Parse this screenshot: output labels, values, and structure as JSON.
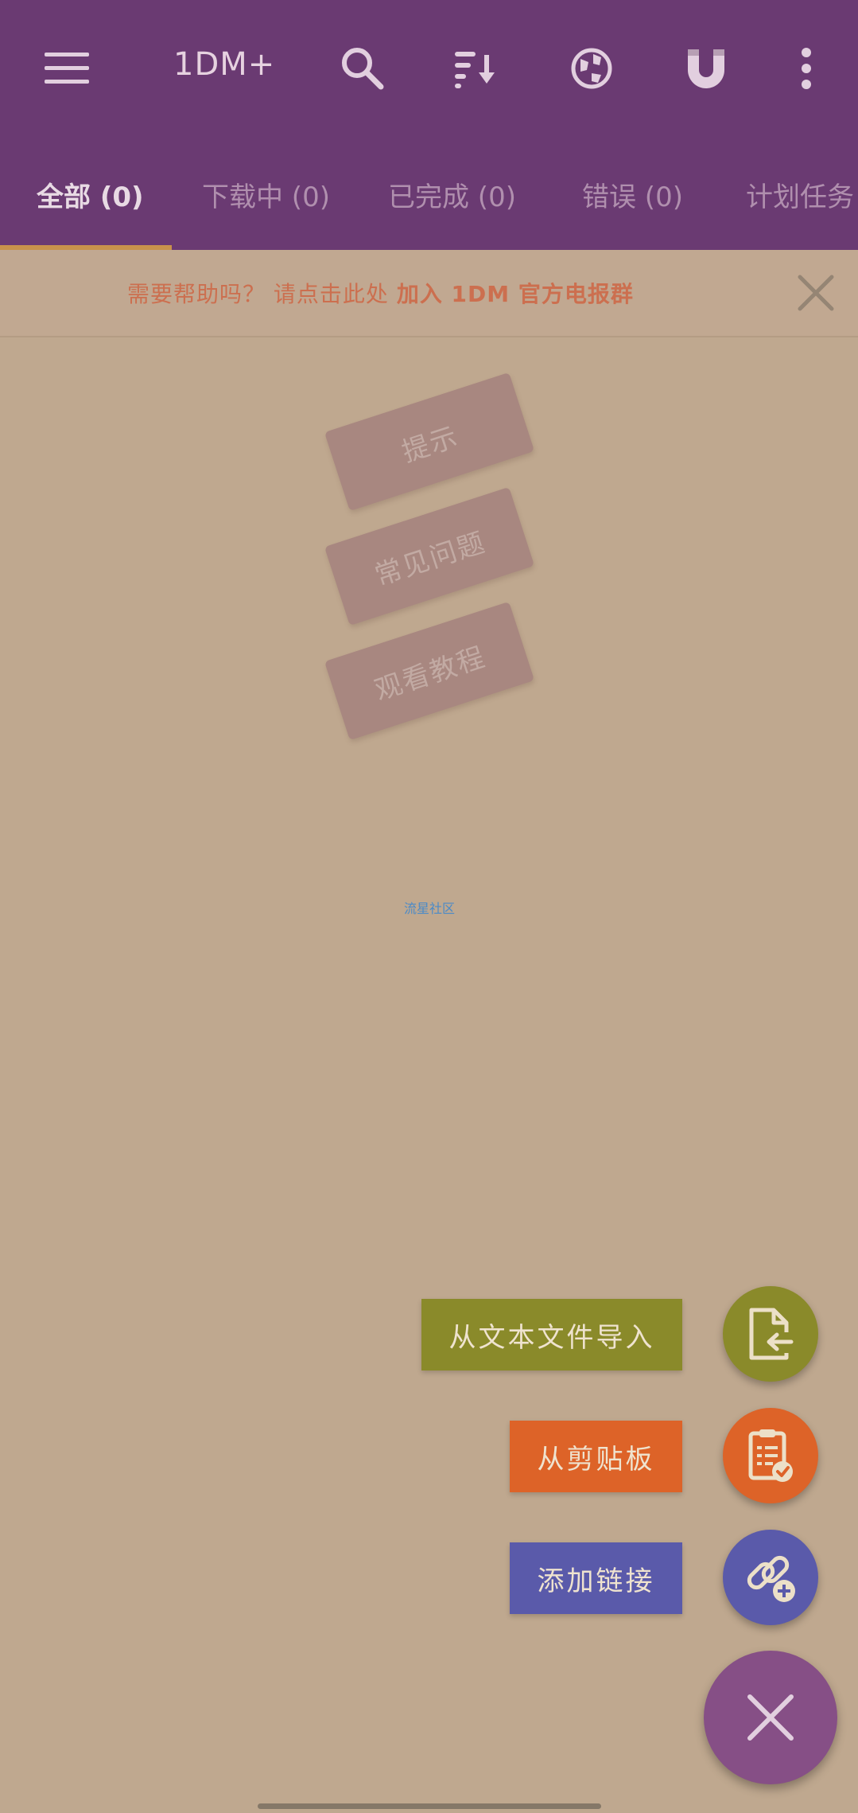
{
  "app_bar": {
    "title": "1DM+",
    "icons": [
      "menu-icon",
      "search-icon",
      "sort-icon",
      "browser-globe-icon",
      "magnet-icon",
      "more-vert-icon"
    ],
    "background": "#6a3a72"
  },
  "tabs": [
    {
      "label": "全部 (0)",
      "active": true
    },
    {
      "label": "下载中 (0)",
      "active": false
    },
    {
      "label": "已完成 (0)",
      "active": false
    },
    {
      "label": "错误 (0)",
      "active": false
    },
    {
      "label": "计划任务",
      "active": false
    }
  ],
  "banner": {
    "text_prefix": "需要帮助吗？ 请点击此处 ",
    "text_bold": "加入 1DM 官方电报群",
    "close_icon": "close-icon",
    "color": "#cc6f4f"
  },
  "hints": [
    {
      "label": "提示"
    },
    {
      "label": "常见问题"
    },
    {
      "label": "观看教程"
    }
  ],
  "watermark": "流星社区",
  "fab_menu": {
    "import_text": {
      "label": "从文本文件导入",
      "color": "#8a8a2a",
      "icon": "file-import-icon"
    },
    "clipboard": {
      "label": "从剪贴板",
      "color": "#dd6328",
      "icon": "clipboard-check-icon"
    },
    "add_link": {
      "label": "添加链接",
      "color": "#5a5aaa",
      "icon": "link-add-icon"
    },
    "main_icon": "close-icon",
    "main_color": "#864f86"
  }
}
